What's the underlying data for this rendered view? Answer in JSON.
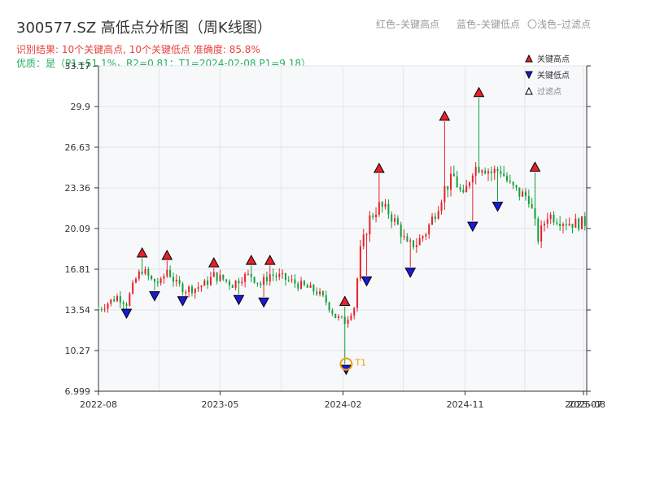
{
  "header": {
    "title": "300577.SZ 高低点分析图（周K线图）",
    "hint_red": "红色–关键高点",
    "hint_blue": "蓝色–关键低点",
    "hint_light": "〇浅色–过滤点",
    "result": "识别结果: 10个关键高点, 10个关键低点   准确度: 85.8%",
    "quality": "优质：是（P1=51.1%，R2=0.81；T1=2024-02-08 P1=9.18）"
  },
  "colors": {
    "up": "#e8202a",
    "down": "#12a03c",
    "high_marker": "#e8202a",
    "low_marker": "#1a1ad9",
    "t1": "#f39c12",
    "plot_bg": "#f7f8fa",
    "grid": "#e3e5ea"
  },
  "chart_data": {
    "type": "candlestick",
    "title": "300577.SZ 高低点分析图（周K线图）",
    "x_ticks": [
      "2022-08",
      "2023-05",
      "2024-02",
      "2024-11",
      "2025-07",
      "2025-08"
    ],
    "y_ticks": [
      6.999,
      10.27,
      13.54,
      16.81,
      20.09,
      23.36,
      26.63,
      29.9,
      33.17
    ],
    "y_range": [
      6.999,
      33.17
    ],
    "x_range": [
      "2022-08-01",
      "2025-08-01"
    ],
    "grid": true,
    "legend_position": "top-right",
    "legend": [
      {
        "label": "关键高点",
        "marker": "up-triangle",
        "color": "#e8202a"
      },
      {
        "label": "关键低点",
        "marker": "down-triangle",
        "color": "#1a1ad9"
      },
      {
        "label": "过滤点",
        "marker": "hollow-triangle",
        "color": "#ffffff"
      }
    ],
    "key_highs": [
      {
        "date": "2022-11-07",
        "price": 17.7
      },
      {
        "date": "2023-01-02",
        "price": 17.5
      },
      {
        "date": "2023-04-17",
        "price": 16.9
      },
      {
        "date": "2023-07-10",
        "price": 17.1
      },
      {
        "date": "2023-08-21",
        "price": 17.1
      },
      {
        "date": "2024-02-05",
        "price": 13.8
      },
      {
        "date": "2024-04-22",
        "price": 24.5
      },
      {
        "date": "2024-09-16",
        "price": 28.7
      },
      {
        "date": "2024-12-02",
        "price": 30.6
      },
      {
        "date": "2025-04-07",
        "price": 24.6
      }
    ],
    "key_lows": [
      {
        "date": "2022-10-03",
        "price": 13.7
      },
      {
        "date": "2022-12-05",
        "price": 15.1
      },
      {
        "date": "2023-02-06",
        "price": 14.7
      },
      {
        "date": "2023-06-12",
        "price": 14.8
      },
      {
        "date": "2023-08-07",
        "price": 14.6
      },
      {
        "date": "2024-02-08",
        "price": 9.18
      },
      {
        "date": "2024-03-25",
        "price": 16.3
      },
      {
        "date": "2024-07-01",
        "price": 17.0
      },
      {
        "date": "2024-11-18",
        "price": 20.7
      },
      {
        "date": "2025-01-13",
        "price": 22.3
      }
    ],
    "annotation": {
      "label": "T1",
      "date": "2024-02-08",
      "price": 9.18
    },
    "close_series": [
      [
        "2022-08-01",
        13.6
      ],
      [
        "2022-08-22",
        14.1
      ],
      [
        "2022-09-12",
        14.6
      ],
      [
        "2022-10-03",
        14.1
      ],
      [
        "2022-10-24",
        16.0
      ],
      [
        "2022-11-07",
        16.8
      ],
      [
        "2022-11-28",
        15.9
      ],
      [
        "2022-12-19",
        15.7
      ],
      [
        "2023-01-02",
        16.8
      ],
      [
        "2023-01-23",
        15.6
      ],
      [
        "2023-02-13",
        15.2
      ],
      [
        "2023-03-06",
        15.3
      ],
      [
        "2023-03-27",
        15.6
      ],
      [
        "2023-04-17",
        16.3
      ],
      [
        "2023-05-08",
        16.0
      ],
      [
        "2023-05-29",
        15.6
      ],
      [
        "2023-06-19",
        16.2
      ],
      [
        "2023-07-10",
        16.3
      ],
      [
        "2023-07-31",
        15.6
      ],
      [
        "2023-08-21",
        16.4
      ],
      [
        "2023-09-11",
        16.2
      ],
      [
        "2023-10-02",
        15.9
      ],
      [
        "2023-10-23",
        15.6
      ],
      [
        "2023-11-13",
        15.3
      ],
      [
        "2023-12-04",
        15.0
      ],
      [
        "2023-12-25",
        14.2
      ],
      [
        "2024-01-15",
        13.0
      ],
      [
        "2024-02-05",
        12.6
      ],
      [
        "2024-02-26",
        13.8
      ],
      [
        "2024-03-11",
        18.3
      ],
      [
        "2024-04-01",
        20.9
      ],
      [
        "2024-04-22",
        21.9
      ],
      [
        "2024-05-13",
        21.4
      ],
      [
        "2024-06-03",
        20.3
      ],
      [
        "2024-06-24",
        18.7
      ],
      [
        "2024-07-15",
        18.9
      ],
      [
        "2024-08-05",
        19.8
      ],
      [
        "2024-08-26",
        21.4
      ],
      [
        "2024-09-16",
        23.3
      ],
      [
        "2024-10-07",
        24.2
      ],
      [
        "2024-10-28",
        22.5
      ],
      [
        "2024-11-18",
        24.9
      ],
      [
        "2024-12-09",
        25.2
      ],
      [
        "2024-12-30",
        24.6
      ],
      [
        "2025-01-20",
        24.8
      ],
      [
        "2025-02-10",
        23.5
      ],
      [
        "2025-03-03",
        22.9
      ],
      [
        "2025-03-24",
        22.6
      ],
      [
        "2025-04-14",
        19.3
      ],
      [
        "2025-05-05",
        21.2
      ],
      [
        "2025-05-26",
        20.9
      ],
      [
        "2025-06-16",
        20.6
      ],
      [
        "2025-07-07",
        20.5
      ],
      [
        "2025-08-01",
        20.6
      ]
    ]
  }
}
